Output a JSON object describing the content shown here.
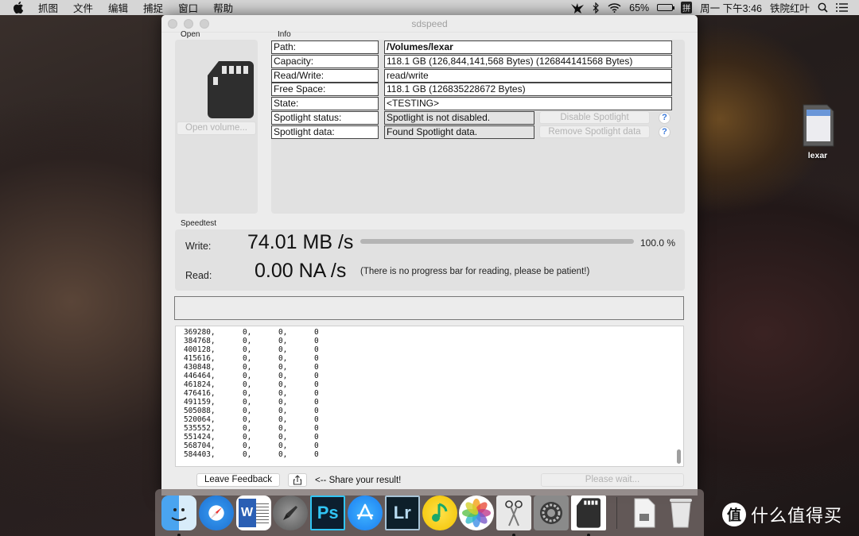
{
  "menubar": {
    "app_menu": [
      "抓图",
      "文件",
      "编辑",
      "捕捉",
      "窗口",
      "帮助"
    ],
    "battery_percent": "65%",
    "battery_level": 0.65,
    "input_method": "拼",
    "datetime": "周一 下午3:46",
    "user": "铁院红叶"
  },
  "window": {
    "title": "sdspeed",
    "open_group": {
      "label": "Open",
      "open_button": "Open volume..."
    },
    "info_group": {
      "label": "Info",
      "rows": [
        {
          "key": "Path:",
          "value": "/Volumes/lexar"
        },
        {
          "key": "Capacity:",
          "value": "118.1 GB (126,844,141,568 Bytes) (126844141568 Bytes)"
        },
        {
          "key": "Read/Write:",
          "value": "read/write"
        },
        {
          "key": "Free Space:",
          "value": "118.1 GB (126835228672 Bytes)"
        },
        {
          "key": "State:",
          "value": "<TESTING>"
        },
        {
          "key": "Spotlight status:",
          "value": "Spotlight is not disabled."
        },
        {
          "key": "Spotlight data:",
          "value": "Found Spotlight data."
        }
      ],
      "disable_spotlight_button": "Disable Spotlight",
      "remove_spotlight_button": "Remove Spotlight data",
      "help_glyph": "?"
    },
    "speedtest": {
      "label": "Speedtest",
      "write_label": "Write:",
      "write_value": "74.01 MB /s",
      "write_progress_percent": 100.0,
      "write_progress_text": "100.0 %",
      "read_label": "Read:",
      "read_value": "0.00 NA  /s",
      "read_note": "(There is no progress bar for reading, please be patient!)"
    },
    "log": {
      "rows": [
        [
          "369280,",
          "0,",
          "0,",
          "0"
        ],
        [
          "384768,",
          "0,",
          "0,",
          "0"
        ],
        [
          "400128,",
          "0,",
          "0,",
          "0"
        ],
        [
          "415616,",
          "0,",
          "0,",
          "0"
        ],
        [
          "430848,",
          "0,",
          "0,",
          "0"
        ],
        [
          "446464,",
          "0,",
          "0,",
          "0"
        ],
        [
          "461824,",
          "0,",
          "0,",
          "0"
        ],
        [
          "476416,",
          "0,",
          "0,",
          "0"
        ],
        [
          "491159,",
          "0,",
          "0,",
          "0"
        ],
        [
          "505088,",
          "0,",
          "0,",
          "0"
        ],
        [
          "520064,",
          "0,",
          "0,",
          "0"
        ],
        [
          "535552,",
          "0,",
          "0,",
          "0"
        ],
        [
          "551424,",
          "0,",
          "0,",
          "0"
        ],
        [
          "568704,",
          "0,",
          "0,",
          "0"
        ],
        [
          "584403,",
          "0,",
          "0,",
          "0"
        ]
      ]
    },
    "footer": {
      "feedback_button": "Leave Feedback",
      "share_text": "<-- Share your result!",
      "wait_button": "Please wait..."
    }
  },
  "desktop": {
    "volume_label": "lexar",
    "watermark_badge": "值",
    "watermark_text": "什么值得买"
  },
  "dock": {
    "apps": [
      {
        "name": "Finder",
        "running": true
      },
      {
        "name": "Safari",
        "running": false
      },
      {
        "name": "Word",
        "running": false
      },
      {
        "name": "Launchpad",
        "running": false
      },
      {
        "name": "Photoshop",
        "glyph": "Ps",
        "running": false
      },
      {
        "name": "App Store",
        "running": false
      },
      {
        "name": "Lightroom",
        "glyph": "Lr",
        "running": false
      },
      {
        "name": "QQ Music",
        "running": false
      },
      {
        "name": "Photos",
        "running": false
      },
      {
        "name": "Screenshot",
        "running": true
      },
      {
        "name": "System Preferences",
        "running": false
      },
      {
        "name": "sdspeed",
        "running": true
      }
    ],
    "w_glyph": "W"
  }
}
